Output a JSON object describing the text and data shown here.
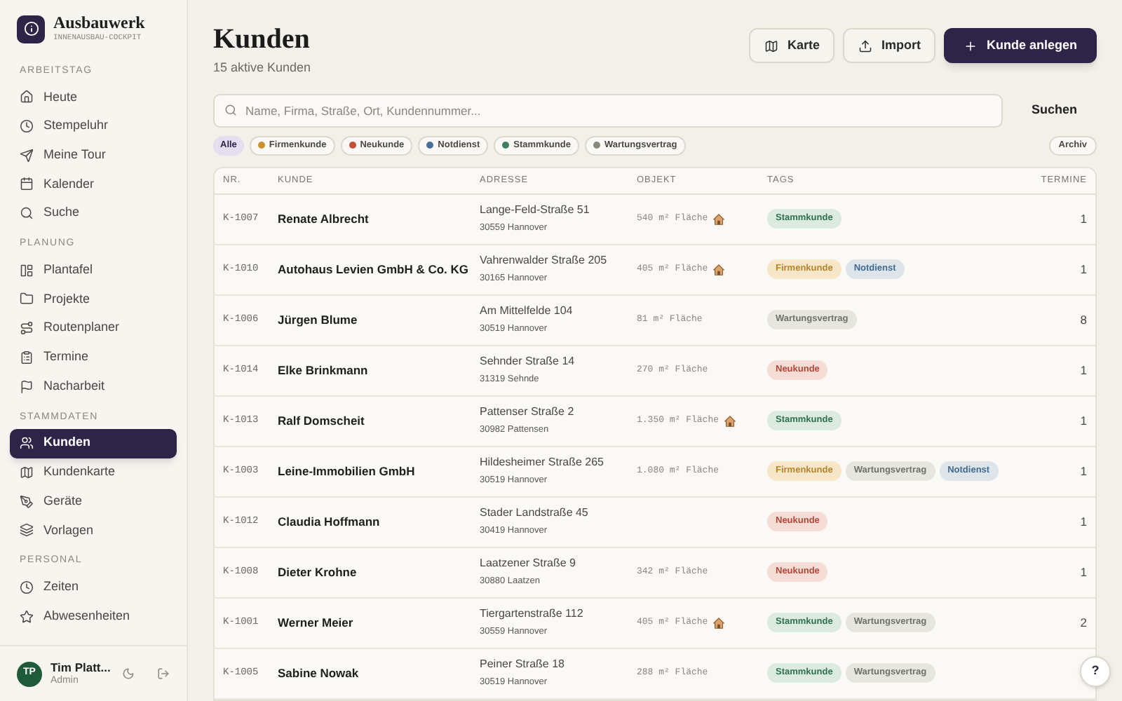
{
  "brand": {
    "name": "Ausbauwerk",
    "subtitle": "INNENAUSBAU-COCKPIT"
  },
  "sidebar": {
    "sections": [
      {
        "title": "ARBEITSTAG",
        "items": [
          {
            "label": "Heute",
            "selected": false
          },
          {
            "label": "Stempeluhr",
            "selected": false
          },
          {
            "label": "Meine Tour",
            "selected": false
          },
          {
            "label": "Kalender",
            "selected": false
          },
          {
            "label": "Suche",
            "selected": false
          }
        ]
      },
      {
        "title": "PLANUNG",
        "items": [
          {
            "label": "Plantafel",
            "selected": false
          },
          {
            "label": "Projekte",
            "selected": false
          },
          {
            "label": "Routenplaner",
            "selected": false
          },
          {
            "label": "Termine",
            "selected": false
          },
          {
            "label": "Nacharbeit",
            "selected": false
          }
        ]
      },
      {
        "title": "STAMMDATEN",
        "items": [
          {
            "label": "Kunden",
            "selected": true
          },
          {
            "label": "Kundenkarte",
            "selected": false
          },
          {
            "label": "Geräte",
            "selected": false
          },
          {
            "label": "Vorlagen",
            "selected": false
          }
        ]
      },
      {
        "title": "PERSONAL",
        "items": [
          {
            "label": "Zeiten",
            "selected": false
          },
          {
            "label": "Abwesenheiten",
            "selected": false
          }
        ]
      }
    ]
  },
  "user": {
    "initials": "TP",
    "name": "Tim Platt...",
    "role": "Admin"
  },
  "header": {
    "title": "Kunden",
    "subtitle": "15 aktive Kunden",
    "buttons": [
      {
        "label": "Karte",
        "kind": "secondary"
      },
      {
        "label": "Import",
        "kind": "secondary"
      },
      {
        "label": "Kunde anlegen",
        "kind": "primary"
      }
    ]
  },
  "search": {
    "placeholder": "Name, Firma, Straße, Ort, Kundennummer...",
    "button": "Suchen"
  },
  "filters": [
    {
      "label": "Alle",
      "selected": true
    },
    {
      "label": "Firmenkunde",
      "color": "#c9922e",
      "selected": false
    },
    {
      "label": "Neukunde",
      "color": "#c0503a",
      "selected": false
    },
    {
      "label": "Notdienst",
      "color": "#4a6f95",
      "selected": false
    },
    {
      "label": "Stammkunde",
      "color": "#3d8060",
      "selected": false
    },
    {
      "label": "Wartungsvertrag",
      "color": "#85887d",
      "selected": false
    }
  ],
  "archive": "Archiv",
  "table": {
    "columns": [
      "NR.",
      "KUNDE",
      "ADRESSE",
      "OBJEKT",
      "TAGS",
      "TERMINE"
    ],
    "rows": [
      {
        "nr": "K-1007",
        "name": "Renate Albrecht",
        "street": "Lange-Feld-Straße 51",
        "city": "30559 Hannover",
        "object": "540 m² Fläche",
        "house": true,
        "tags": [
          {
            "label": "Stammkunde",
            "kind": "stamm"
          }
        ],
        "termine": "1"
      },
      {
        "nr": "K-1010",
        "name": "Autohaus Levien GmbH & Co. KG",
        "street": "Vahrenwalder Straße 205",
        "city": "30165 Hannover",
        "object": "405 m² Fläche",
        "house": true,
        "tags": [
          {
            "label": "Firmenkunde",
            "kind": "firma"
          },
          {
            "label": "Notdienst",
            "kind": "not"
          }
        ],
        "termine": "1"
      },
      {
        "nr": "K-1006",
        "name": "Jürgen Blume",
        "street": "Am Mittelfelde 104",
        "city": "30519 Hannover",
        "object": "81 m² Fläche",
        "house": false,
        "tags": [
          {
            "label": "Wartungsvertrag",
            "kind": "wartung"
          }
        ],
        "termine": "8"
      },
      {
        "nr": "K-1014",
        "name": "Elke Brinkmann",
        "street": "Sehnder Straße 14",
        "city": "31319 Sehnde",
        "object": "270 m² Fläche",
        "house": false,
        "tags": [
          {
            "label": "Neukunde",
            "kind": "neu"
          }
        ],
        "termine": "1"
      },
      {
        "nr": "K-1013",
        "name": "Ralf Domscheit",
        "street": "Pattenser Straße 2",
        "city": "30982 Pattensen",
        "object": "1.350 m² Fläche",
        "house": true,
        "tags": [
          {
            "label": "Stammkunde",
            "kind": "stamm"
          }
        ],
        "termine": "1"
      },
      {
        "nr": "K-1003",
        "name": "Leine-Immobilien GmbH",
        "street": "Hildesheimer Straße 265",
        "city": "30519 Hannover",
        "object": "1.080 m² Fläche",
        "house": false,
        "tags": [
          {
            "label": "Firmenkunde",
            "kind": "firma"
          },
          {
            "label": "Wartungsvertrag",
            "kind": "wartung"
          },
          {
            "label": "Notdienst",
            "kind": "not"
          }
        ],
        "termine": "1"
      },
      {
        "nr": "K-1012",
        "name": "Claudia Hoffmann",
        "street": "Stader Landstraße 45",
        "city": "30419 Hannover",
        "house": false,
        "tags": [
          {
            "label": "Neukunde",
            "kind": "neu"
          }
        ],
        "termine": "1"
      },
      {
        "nr": "K-1008",
        "name": "Dieter Krohne",
        "street": "Laatzener Straße 9",
        "city": "30880 Laatzen",
        "object": "342 m² Fläche",
        "house": false,
        "tags": [
          {
            "label": "Neukunde",
            "kind": "neu"
          }
        ],
        "termine": "1"
      },
      {
        "nr": "K-1001",
        "name": "Werner Meier",
        "street": "Tiergartenstraße 112",
        "city": "30559 Hannover",
        "object": "405 m² Fläche",
        "house": true,
        "tags": [
          {
            "label": "Stammkunde",
            "kind": "stamm"
          },
          {
            "label": "Wartungsvertrag",
            "kind": "wartung"
          }
        ],
        "termine": "2"
      },
      {
        "nr": "K-1005",
        "name": "Sabine Nowak",
        "street": "Peiner Straße 18",
        "city": "30519 Hannover",
        "object": "288 m² Fläche",
        "house": false,
        "tags": [
          {
            "label": "Stammkunde",
            "kind": "stamm"
          },
          {
            "label": "Wartungsvertrag",
            "kind": "wartung"
          }
        ]
      }
    ]
  },
  "help": "?"
}
